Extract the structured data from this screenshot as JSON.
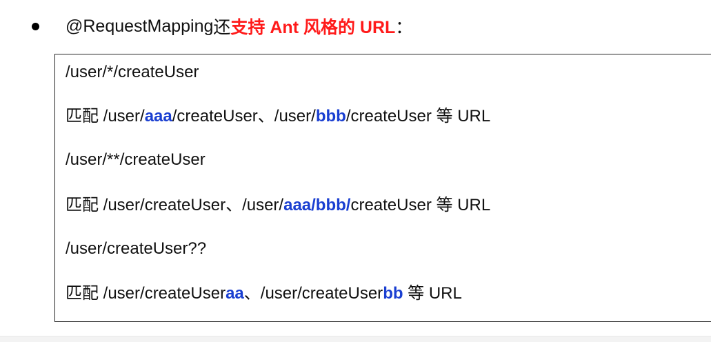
{
  "heading": {
    "annotation": "@RequestMapping",
    "plain": " 还",
    "highlight": "支持 Ant 风格的 URL",
    "suffix": "："
  },
  "box": {
    "line1": "/user/*/createUser",
    "line2": {
      "prefix": "匹配 /user/",
      "hl1": "aaa",
      "mid": "/createUser、/user/",
      "hl2": "bbb",
      "suffix": "/createUser 等 URL"
    },
    "line3": "/user/**/createUser",
    "line4": {
      "prefix": "匹配 /user/createUser、/user/",
      "hl1": "aaa/bbb/",
      "suffix": "createUser 等 URL"
    },
    "line5": "/user/createUser??",
    "line6": {
      "prefix": "匹配 /user/createUser",
      "hl1": "aa",
      "mid": "、/user/createUser",
      "hl2": "bb",
      "suffix": " 等 URL"
    }
  },
  "colors": {
    "red": "#ff1a1a",
    "blue": "#1a3fd1",
    "text": "#111111"
  }
}
